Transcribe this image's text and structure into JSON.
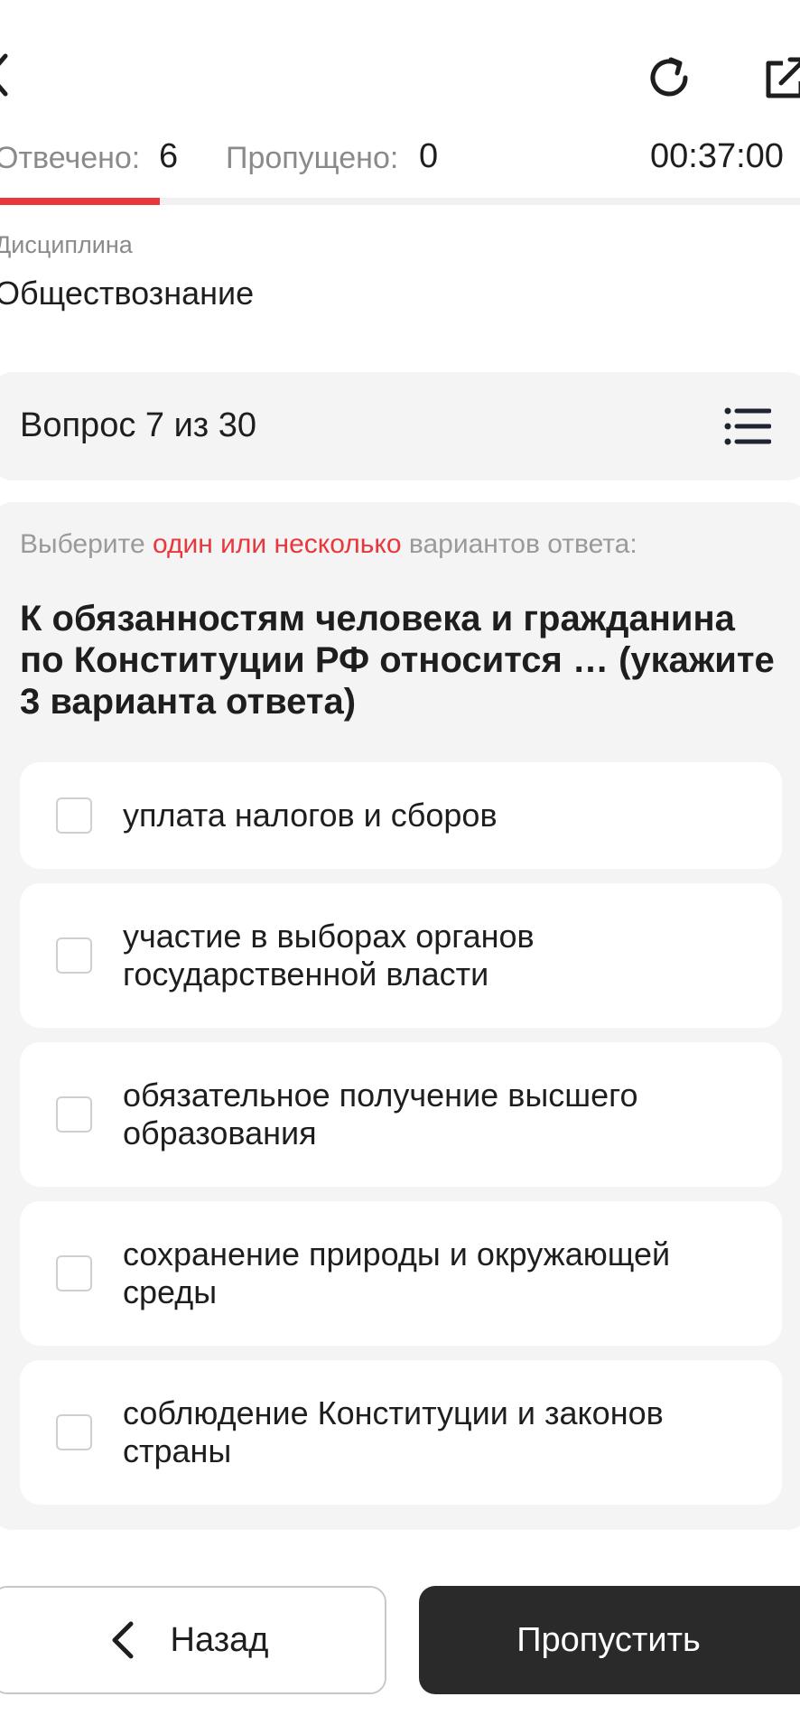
{
  "header": {
    "back_icon": "chevron-left-icon",
    "refresh_icon": "refresh-icon",
    "share_icon": "external-link-icon"
  },
  "stats": {
    "answered_label": "Отвечено:",
    "answered_value": "6",
    "skipped_label": "Пропущено:",
    "skipped_value": "0",
    "timer": "00:37:00",
    "progress_fraction": 0.2,
    "progress_color": "#e8373d"
  },
  "discipline": {
    "label": "Дисциплина",
    "value": "Обществознание"
  },
  "question": {
    "counter": "Вопрос 7 из 30",
    "list_icon": "list-icon",
    "instruction_prefix": "Выберите ",
    "instruction_accent": "один или несколько",
    "instruction_suffix": " вариантов ответа:",
    "text": "К обязанностям человека и гражданина по Конституции РФ относится … (укажите 3 варианта ответа)",
    "options": [
      {
        "label": "уплата налогов и сборов",
        "checked": false
      },
      {
        "label": "участие в выборах органов государственной власти",
        "checked": false
      },
      {
        "label": "обязательное получение высшего образования",
        "checked": false
      },
      {
        "label": "сохранение природы и окружающей среды",
        "checked": false
      },
      {
        "label": "соблюдение Конституции и законов страны",
        "checked": false
      }
    ]
  },
  "footer": {
    "back_label": "Назад",
    "skip_label": "Пропустить"
  }
}
